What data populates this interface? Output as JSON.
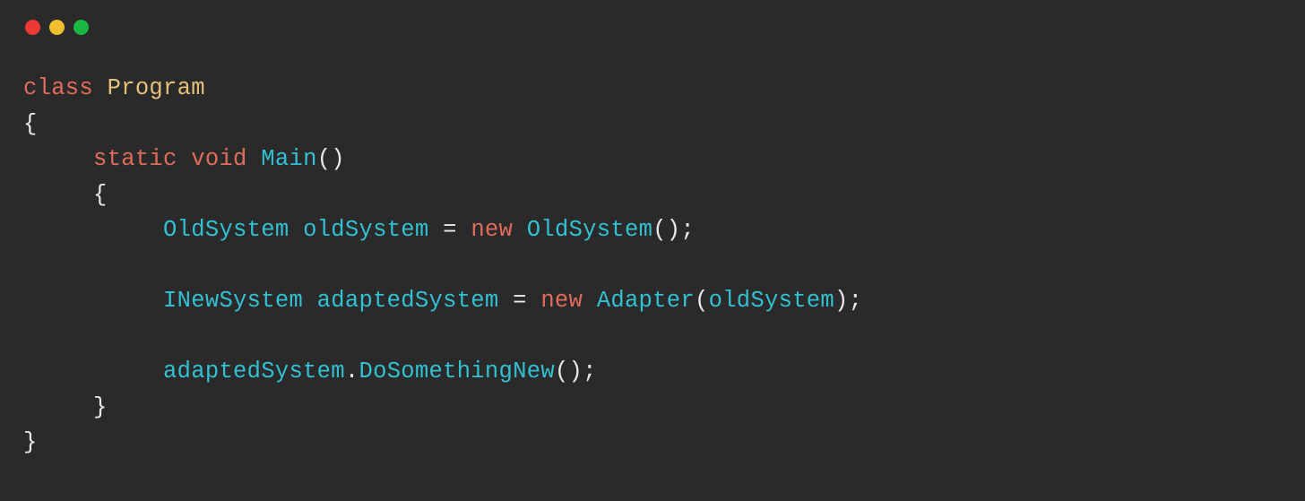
{
  "window": {
    "controls": [
      "close",
      "minimize",
      "maximize"
    ]
  },
  "code": {
    "kw_class": "class",
    "class_name": "Program",
    "brace_open": "{",
    "brace_close": "}",
    "indent1": "     ",
    "indent2": "          ",
    "kw_static": "static",
    "kw_void": "void",
    "method_main": "Main",
    "parens_empty": "()",
    "type_oldsystem": "OldSystem",
    "var_oldsystem": "oldSystem",
    "eq": " = ",
    "kw_new": "new",
    "ctor_oldsystem": "OldSystem",
    "semicolon": ";",
    "type_inewsystem": "INewSystem",
    "var_adaptedsystem": "adaptedSystem",
    "ctor_adapter": "Adapter",
    "paren_open": "(",
    "paren_close": ")",
    "dot": ".",
    "method_dosomethingnew": "DoSomethingNew",
    "space": " "
  }
}
